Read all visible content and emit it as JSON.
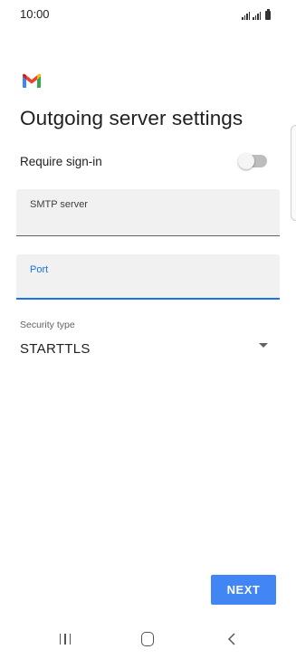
{
  "status_bar": {
    "time": "10:00"
  },
  "app": {
    "logo_icon": "gmail-logo"
  },
  "page": {
    "title": "Outgoing server settings"
  },
  "sign_in": {
    "label": "Require sign-in",
    "enabled": false
  },
  "fields": {
    "smtp": {
      "label": "SMTP server",
      "value": ""
    },
    "port": {
      "label": "Port",
      "value": ""
    }
  },
  "security": {
    "label": "Security type",
    "selected": "STARTTLS"
  },
  "actions": {
    "next_label": "NEXT"
  },
  "colors": {
    "accent": "#4285f4",
    "focus": "#1a73e8",
    "gmail_red": "#ea4335",
    "gmail_blue": "#4285f4",
    "gmail_green": "#34a853",
    "gmail_yellow": "#fbbc04"
  },
  "nav": {
    "recents_icon": "recents-icon",
    "home_icon": "home-icon",
    "back_icon": "back-icon"
  }
}
